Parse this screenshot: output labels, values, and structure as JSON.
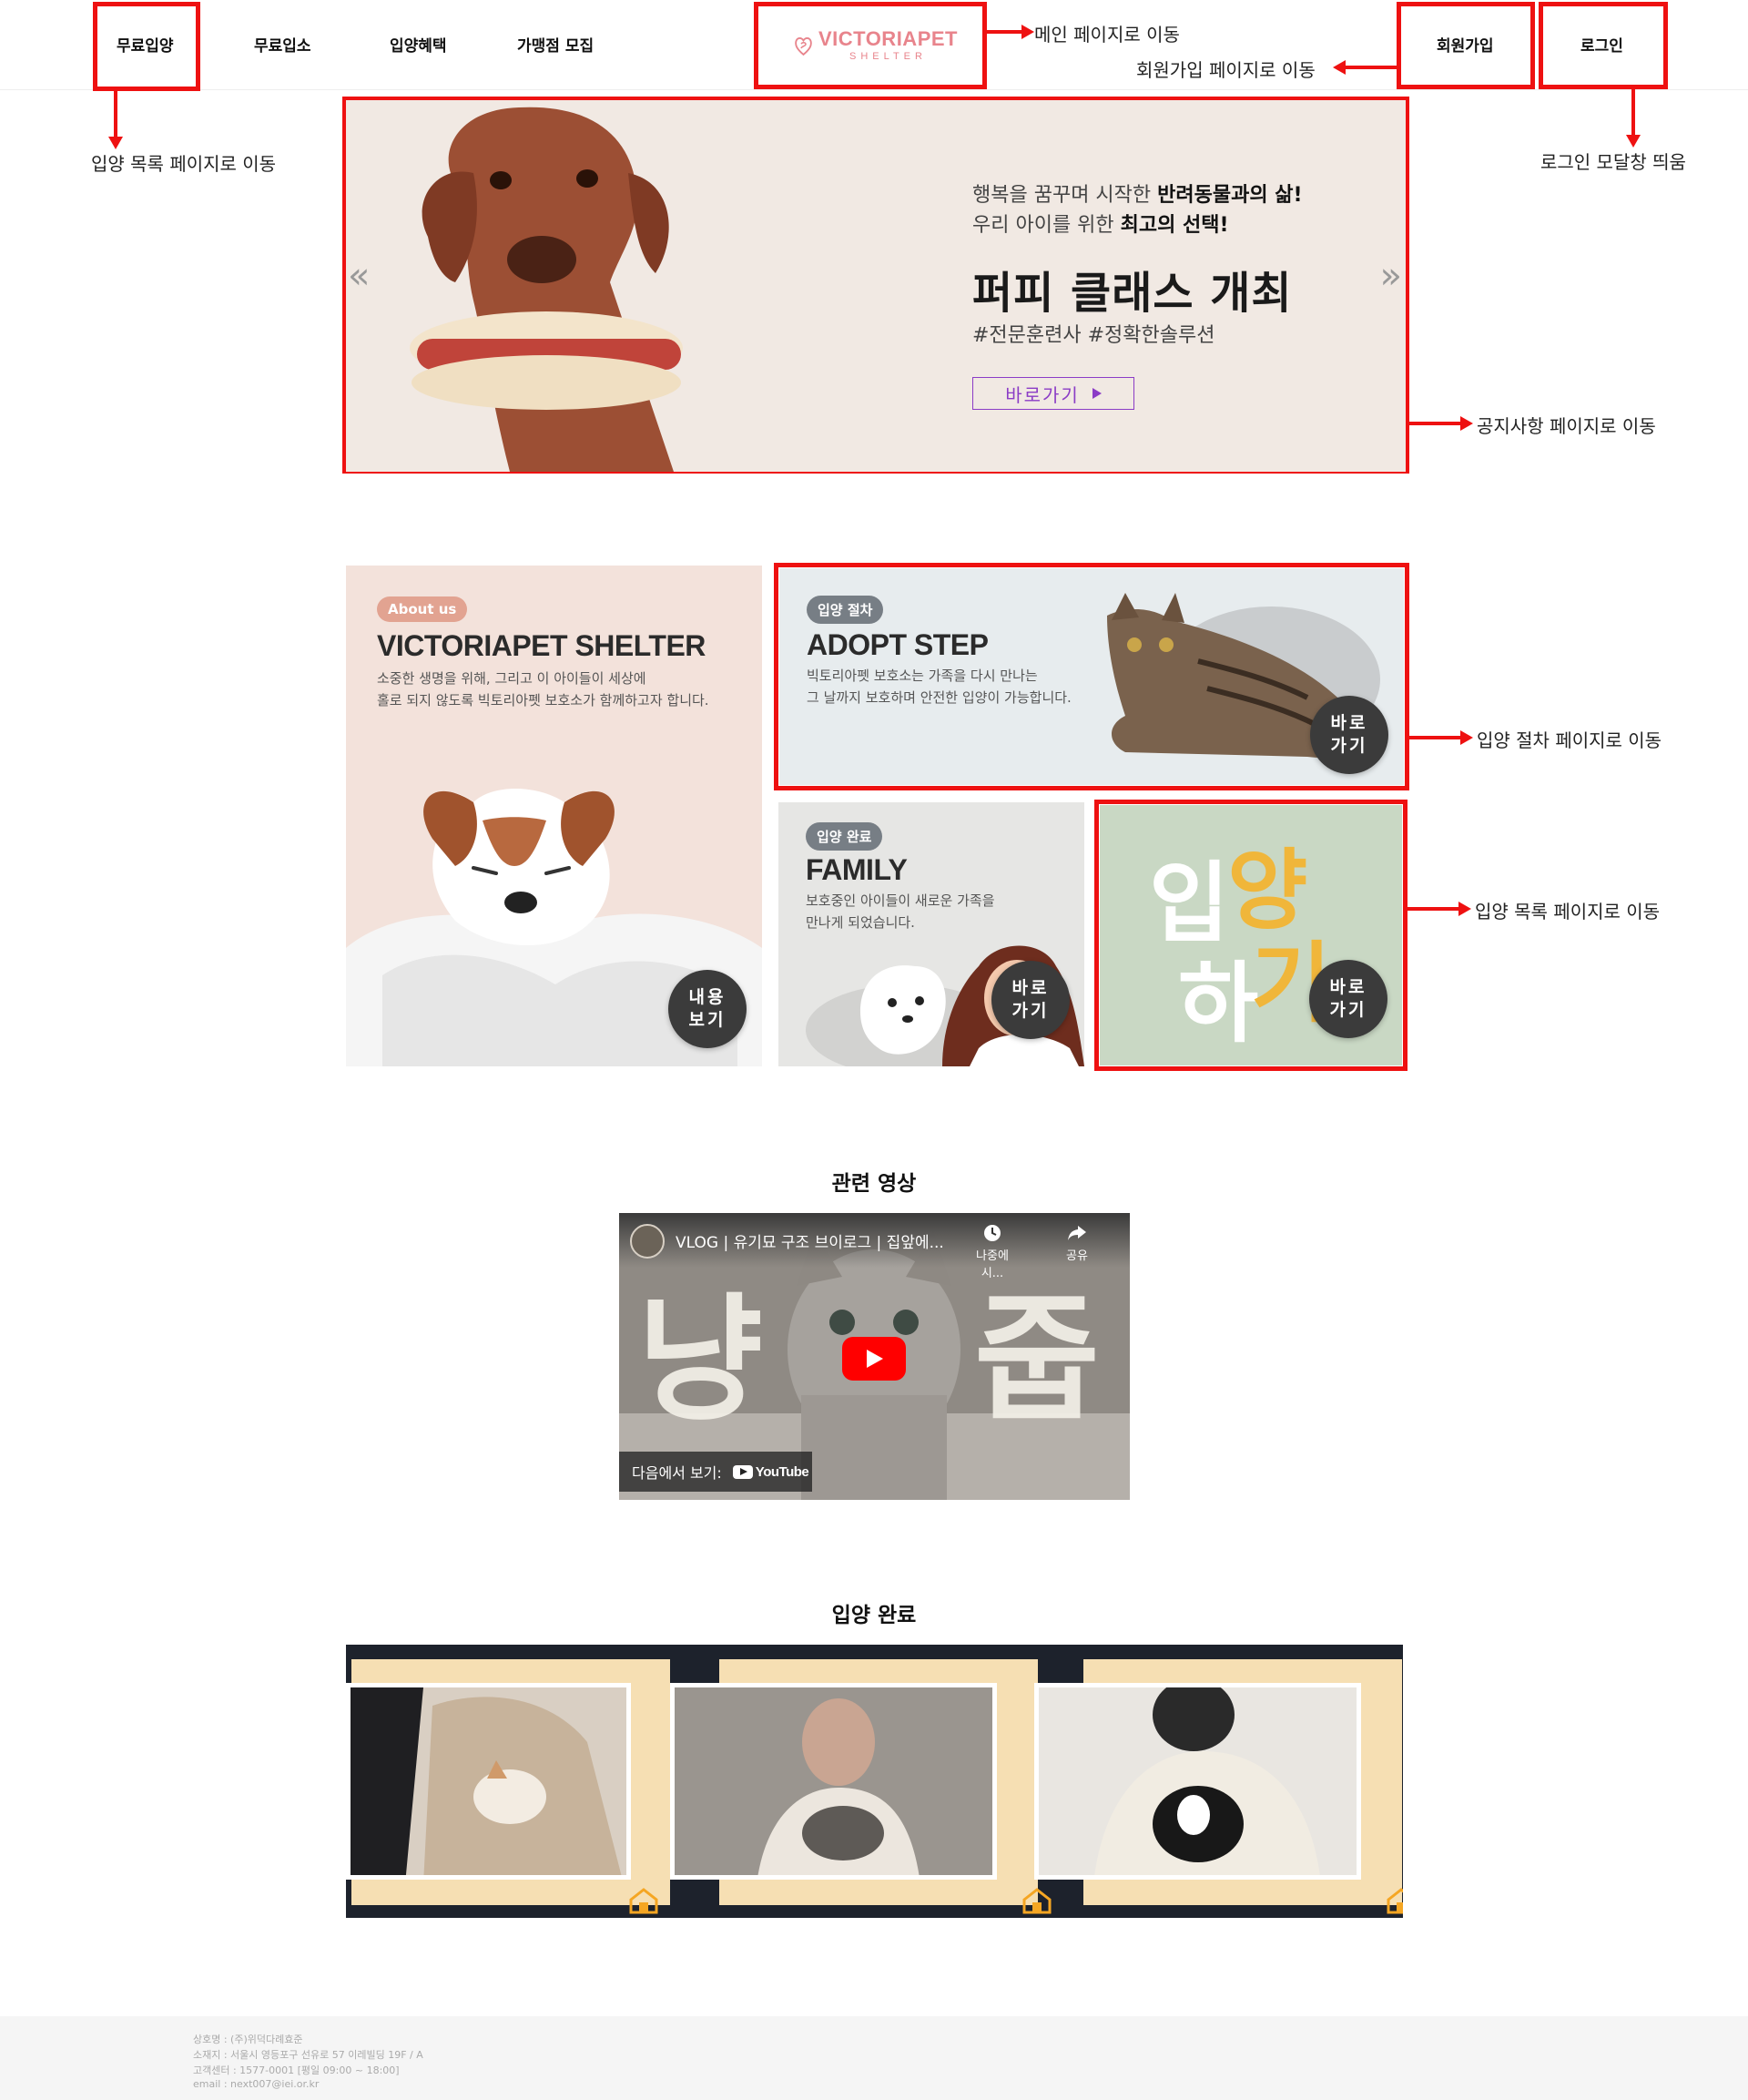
{
  "header": {
    "nav": [
      "무료입양",
      "무료입소",
      "입양혜택",
      "가맹점 모집"
    ],
    "logo_name": "VICTORIAPET",
    "logo_sub": "SHELTER",
    "signup": "회원가입",
    "login": "로그인"
  },
  "annotations": {
    "main_page": "메인 페이지로 이동",
    "signup_page": "회원가입 페이지로 이동",
    "adoption_list": "입양 목록 페이지로 이동",
    "login_modal": "로그인 모달창 띄움",
    "notice_page": "공지사항 페이지로 이동",
    "adoption_step_page": "입양 절차 페이지로 이동",
    "adoption_list_2": "입양 목록 페이지로 이동"
  },
  "hero": {
    "line1_pre": "행복을 꿈꾸며 시작한 ",
    "line1_bold": "반려동물과의 삶!",
    "line2_pre": "우리 아이를 위한 ",
    "line2_bold": "최고의 선택!",
    "title": "퍼피 클래스 개최",
    "tags": "#전문훈련사 #정확한솔루션",
    "button": "바로가기",
    "prev": "«",
    "next": "»"
  },
  "cards": {
    "about": {
      "badge": "About us",
      "title": "VICTORIAPET SHELTER",
      "desc": "소중한 생명을 위해, 그리고 이 아이들이 세상에\n홀로 되지 않도록 빅토리아펫 보호소가 함께하고자 합니다.",
      "button": "내용\n보기"
    },
    "adopt_step": {
      "badge": "입양 절차",
      "title": "ADOPT STEP",
      "desc": "빅토리아펫 보호소는 가족을 다시 만나는\n그 날까지 보호하며 안전한 입양이 가능합니다.",
      "button": "바로\n가기"
    },
    "family": {
      "badge": "입양 완료",
      "title": "FAMILY",
      "desc": "보호중인 아이들이 새로운 가족을\n만나게 되었습니다.",
      "button": "바로\n가기"
    },
    "adopt_go": {
      "big1": "입",
      "big2": "양",
      "big3": "하",
      "big4": "기",
      "button": "바로\n가기"
    }
  },
  "video_section": {
    "title": "관련 영상",
    "video_title": "VLOG | 유기묘 구조 브이로그 | 집앞에...",
    "watch_later": "나중에 시...",
    "share": "공유",
    "watch_on": "다음에서 보기:",
    "youtube": "YouTube",
    "text_left": "냥",
    "text_right": "줍"
  },
  "adoption_section": {
    "title": "입양 완료"
  },
  "footer": {
    "line1": "상호명 : (주)위덕다례효준",
    "line2": "소재지 : 서울시 영등포구 선유로 57 이레빌딩 19F / A",
    "line3": "고객센터 : 1577-0001 [평일 09:00 ~ 18:00]",
    "line4": "email : next007@iei.or.kr"
  },
  "colors": {
    "accent_red": "#ee1111",
    "logo_pink": "#e8848c",
    "hero_button": "#8b3cc6",
    "gallery_bg": "#1d222c",
    "gallery_frame": "#f6dfb3"
  }
}
